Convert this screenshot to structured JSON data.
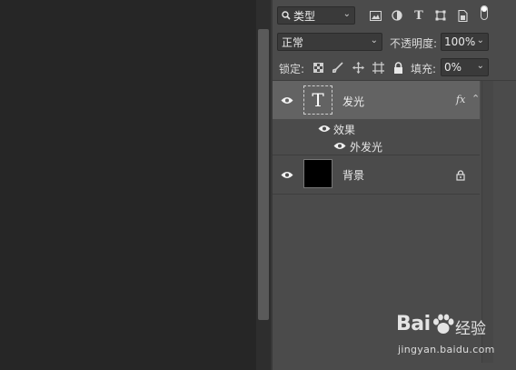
{
  "layers_panel": {
    "filter": {
      "kind_label": "类型",
      "icons": [
        "image-filter-icon",
        "adjustment-filter-icon",
        "type-filter-icon",
        "shape-filter-icon",
        "smart-object-filter-icon"
      ]
    },
    "blend_mode": "正常",
    "opacity_label": "不透明度:",
    "opacity_value": "100%",
    "lock_label": "锁定:",
    "lock_icons": [
      "lock-transparent-icon",
      "lock-image-icon",
      "lock-position-icon",
      "lock-artboard-icon",
      "lock-all-icon"
    ],
    "fill_label": "填充:",
    "fill_value": "0%",
    "layers": [
      {
        "name": "发光",
        "type": "text",
        "thumb_glyph": "T",
        "fx": "fx",
        "selected": true
      },
      {
        "effects_label": "效果",
        "effect_name": "外发光"
      },
      {
        "name": "背景",
        "type": "background",
        "locked": true
      }
    ]
  },
  "watermark": {
    "logo_left": "Bai",
    "logo_right": "经验",
    "url": "jingyan.baidu.com"
  }
}
